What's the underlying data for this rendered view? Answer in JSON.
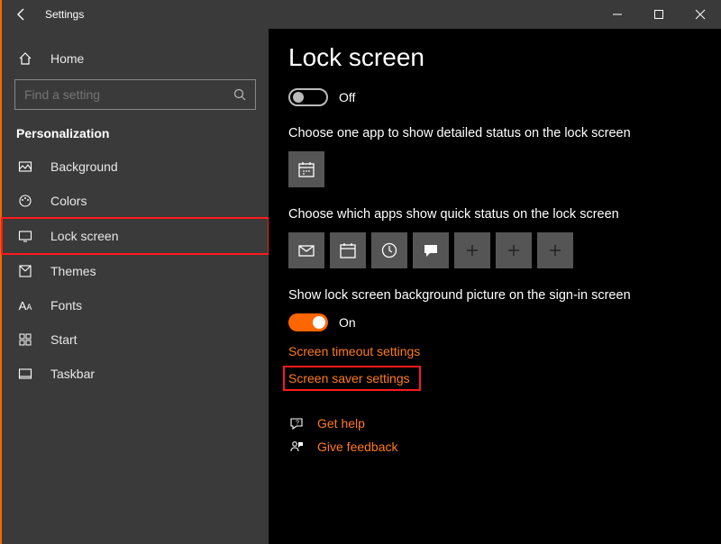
{
  "window": {
    "title": "Settings"
  },
  "sidebar": {
    "home": "Home",
    "search_placeholder": "Find a setting",
    "category": "Personalization",
    "items": [
      {
        "label": "Background"
      },
      {
        "label": "Colors"
      },
      {
        "label": "Lock screen"
      },
      {
        "label": "Themes"
      },
      {
        "label": "Fonts"
      },
      {
        "label": "Start"
      },
      {
        "label": "Taskbar"
      }
    ]
  },
  "page": {
    "title": "Lock screen",
    "toggle1_state": "Off",
    "detailed_label": "Choose one app to show detailed status on the lock screen",
    "quick_label": "Choose which apps show quick status on the lock screen",
    "signin_label": "Show lock screen background picture on the sign-in screen",
    "toggle2_state": "On",
    "link_timeout": "Screen timeout settings",
    "link_saver": "Screen saver settings",
    "get_help": "Get help",
    "give_feedback": "Give feedback"
  }
}
